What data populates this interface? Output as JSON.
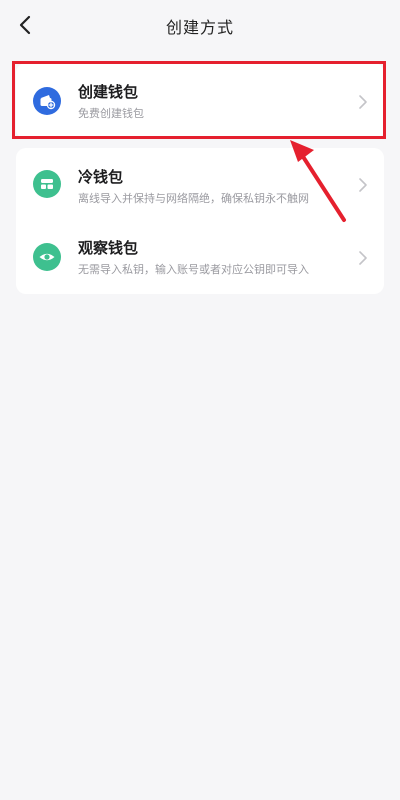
{
  "header": {
    "title": "创建方式"
  },
  "options": [
    {
      "title": "创建钱包",
      "subtitle": "免费创建钱包",
      "icon": "wallet-add-icon",
      "color": "#2f6bdf"
    },
    {
      "title": "冷钱包",
      "subtitle": "离线导入并保持与网络隔绝，确保私钥永不触网",
      "icon": "cold-wallet-icon",
      "color": "#3ec08f"
    },
    {
      "title": "观察钱包",
      "subtitle": "无需导入私钥，输入账号或者对应公钥即可导入",
      "icon": "eye-icon",
      "color": "#3ec08f"
    }
  ],
  "colors": {
    "highlight": "#e5202e",
    "background": "#f6f6f8"
  }
}
